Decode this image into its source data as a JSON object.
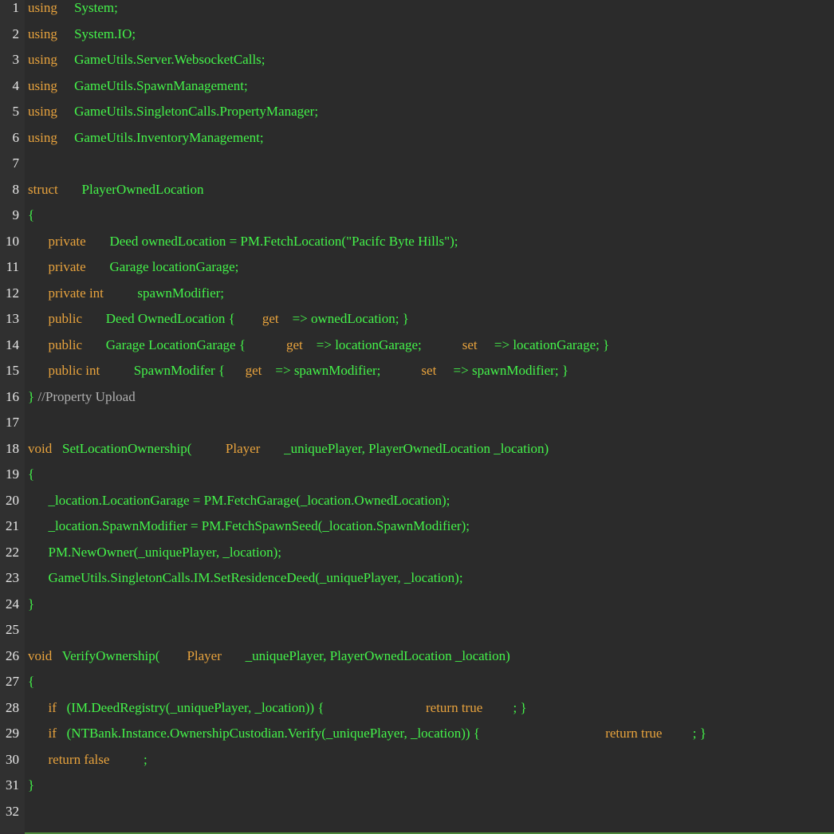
{
  "editor": {
    "lines": [
      {
        "n": "1",
        "tokens": [
          [
            "kw",
            "using"
          ],
          [
            "sp",
            "     "
          ],
          [
            "id",
            "System;"
          ]
        ]
      },
      {
        "n": "2",
        "tokens": [
          [
            "kw",
            "using"
          ],
          [
            "sp",
            "     "
          ],
          [
            "id",
            "System.IO;"
          ]
        ]
      },
      {
        "n": "3",
        "tokens": [
          [
            "kw",
            "using"
          ],
          [
            "sp",
            "     "
          ],
          [
            "id",
            "GameUtils.Server.WebsocketCalls;"
          ]
        ]
      },
      {
        "n": "4",
        "tokens": [
          [
            "kw",
            "using"
          ],
          [
            "sp",
            "     "
          ],
          [
            "id",
            "GameUtils.SpawnManagement;"
          ]
        ]
      },
      {
        "n": "5",
        "tokens": [
          [
            "kw",
            "using"
          ],
          [
            "sp",
            "     "
          ],
          [
            "id",
            "GameUtils.SingletonCalls.PropertyManager;"
          ]
        ]
      },
      {
        "n": "6",
        "tokens": [
          [
            "kw",
            "using"
          ],
          [
            "sp",
            "     "
          ],
          [
            "id",
            "GameUtils.InventoryManagement;"
          ]
        ]
      },
      {
        "n": "7",
        "tokens": []
      },
      {
        "n": "8",
        "tokens": [
          [
            "kw",
            "struct"
          ],
          [
            "sp",
            "       "
          ],
          [
            "id",
            "PlayerOwnedLocation"
          ]
        ]
      },
      {
        "n": "9",
        "tokens": [
          [
            "pl",
            "{"
          ]
        ]
      },
      {
        "n": "10",
        "tokens": [
          [
            "sp",
            "      "
          ],
          [
            "kw",
            "private"
          ],
          [
            "sp",
            "       "
          ],
          [
            "id",
            "Deed ownedLocation = PM.FetchLocation(\"Pacifc Byte Hills\");"
          ]
        ]
      },
      {
        "n": "11",
        "tokens": [
          [
            "sp",
            "      "
          ],
          [
            "kw",
            "private"
          ],
          [
            "sp",
            "       "
          ],
          [
            "id",
            "Garage locationGarage;"
          ]
        ]
      },
      {
        "n": "12",
        "tokens": [
          [
            "sp",
            "      "
          ],
          [
            "kw",
            "private int"
          ],
          [
            "sp",
            "          "
          ],
          [
            "id",
            "spawnModifier;"
          ]
        ]
      },
      {
        "n": "13",
        "tokens": [
          [
            "sp",
            "      "
          ],
          [
            "kw",
            "public"
          ],
          [
            "sp",
            "       "
          ],
          [
            "id",
            "Deed OwnedLocation {"
          ],
          [
            "sp",
            "        "
          ],
          [
            "kw",
            "get"
          ],
          [
            "sp",
            "    "
          ],
          [
            "id",
            "=> ownedLocation; }"
          ]
        ]
      },
      {
        "n": "14",
        "tokens": [
          [
            "sp",
            "      "
          ],
          [
            "kw",
            "public"
          ],
          [
            "sp",
            "       "
          ],
          [
            "id",
            "Garage LocationGarage {"
          ],
          [
            "sp",
            "            "
          ],
          [
            "kw",
            "get"
          ],
          [
            "sp",
            "    "
          ],
          [
            "id",
            "=> locationGarage;"
          ],
          [
            "sp",
            "            "
          ],
          [
            "kw",
            "set"
          ],
          [
            "sp",
            "     "
          ],
          [
            "id",
            "=> locationGarage; }"
          ]
        ]
      },
      {
        "n": "15",
        "tokens": [
          [
            "sp",
            "      "
          ],
          [
            "kw",
            "public int"
          ],
          [
            "sp",
            "          "
          ],
          [
            "id",
            "SpawnModifer {"
          ],
          [
            "sp",
            "      "
          ],
          [
            "kw",
            "get"
          ],
          [
            "sp",
            "    "
          ],
          [
            "id",
            "=> spawnModifier;"
          ],
          [
            "sp",
            "            "
          ],
          [
            "kw",
            "set"
          ],
          [
            "sp",
            "     "
          ],
          [
            "id",
            "=> spawnModifier; }"
          ]
        ]
      },
      {
        "n": "16",
        "tokens": [
          [
            "pl",
            "}"
          ],
          [
            "sp",
            " "
          ],
          [
            "cm",
            "//Property Upload"
          ]
        ]
      },
      {
        "n": "17",
        "tokens": []
      },
      {
        "n": "18",
        "tokens": [
          [
            "kw",
            "void"
          ],
          [
            "sp",
            "   "
          ],
          [
            "id",
            "SetLocationOwnership("
          ],
          [
            "sp",
            "          "
          ],
          [
            "kw",
            "Player"
          ],
          [
            "sp",
            "       "
          ],
          [
            "id",
            "_uniquePlayer, PlayerOwnedLocation _location)"
          ]
        ]
      },
      {
        "n": "19",
        "tokens": [
          [
            "pl",
            "{"
          ]
        ]
      },
      {
        "n": "20",
        "tokens": [
          [
            "sp",
            "      "
          ],
          [
            "id",
            "_location.LocationGarage = PM.FetchGarage(_location.OwnedLocation);"
          ]
        ]
      },
      {
        "n": "21",
        "tokens": [
          [
            "sp",
            "      "
          ],
          [
            "id",
            "_location.SpawnModifier = PM.FetchSpawnSeed(_location.SpawnModifier);"
          ]
        ]
      },
      {
        "n": "22",
        "tokens": [
          [
            "sp",
            "      "
          ],
          [
            "id",
            "PM.NewOwner(_uniquePlayer, _location);"
          ]
        ]
      },
      {
        "n": "23",
        "tokens": [
          [
            "sp",
            "      "
          ],
          [
            "id",
            "GameUtils.SingletonCalls.IM.SetResidenceDeed(_uniquePlayer, _location);"
          ]
        ]
      },
      {
        "n": "24",
        "tokens": [
          [
            "pl",
            "}"
          ]
        ]
      },
      {
        "n": "25",
        "tokens": []
      },
      {
        "n": "26",
        "tokens": [
          [
            "kw",
            "void"
          ],
          [
            "sp",
            "   "
          ],
          [
            "id",
            "VerifyOwnership("
          ],
          [
            "sp",
            "        "
          ],
          [
            "kw",
            "Player"
          ],
          [
            "sp",
            "       "
          ],
          [
            "id",
            "_uniquePlayer, PlayerOwnedLocation _location)"
          ]
        ]
      },
      {
        "n": "27",
        "tokens": [
          [
            "pl",
            "{"
          ]
        ]
      },
      {
        "n": "28",
        "tokens": [
          [
            "sp",
            "      "
          ],
          [
            "kw",
            "if"
          ],
          [
            "sp",
            "   "
          ],
          [
            "id",
            "(IM.DeedRegistry(_uniquePlayer, _location)) {"
          ],
          [
            "sp",
            "                              "
          ],
          [
            "kw",
            "return true"
          ],
          [
            "sp",
            "         "
          ],
          [
            "id",
            "; }"
          ]
        ]
      },
      {
        "n": "29",
        "tokens": [
          [
            "sp",
            "      "
          ],
          [
            "kw",
            "if"
          ],
          [
            "sp",
            "   "
          ],
          [
            "id",
            "(NTBank.Instance.OwnershipCustodian.Verify(_uniquePlayer, _location)) {"
          ],
          [
            "sp",
            "                                     "
          ],
          [
            "kw",
            "return true"
          ],
          [
            "sp",
            "         "
          ],
          [
            "id",
            "; }"
          ]
        ]
      },
      {
        "n": "30",
        "tokens": [
          [
            "sp",
            "      "
          ],
          [
            "kw",
            "return false"
          ],
          [
            "sp",
            "          "
          ],
          [
            "id",
            ";"
          ]
        ]
      },
      {
        "n": "31",
        "tokens": [
          [
            "pl",
            "}"
          ]
        ]
      },
      {
        "n": "32",
        "tokens": []
      }
    ]
  },
  "colors": {
    "background": "#2b2b2b",
    "keyword": "#e8a33d",
    "identifier": "#44f34a",
    "comment": "#b0b0b0",
    "line_number": "#e8e8e8"
  }
}
